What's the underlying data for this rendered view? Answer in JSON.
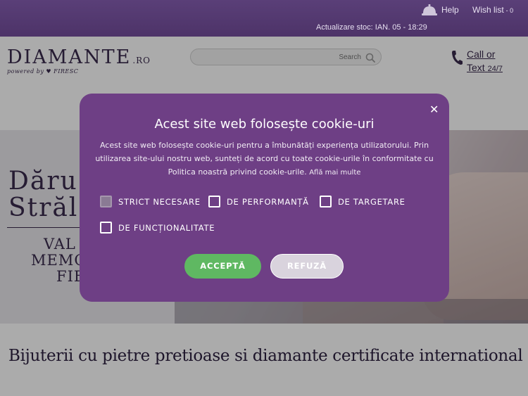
{
  "topbar": {
    "help_label": "Help",
    "wishlist_label": "Wish list",
    "wishlist_count": "- 0",
    "stock_update": "Actualizare stoc: IAN. 05 - 18:29"
  },
  "header": {
    "logo_main": "DIAMANTE",
    "logo_tld": ".RO",
    "logo_powered": "powered by ♥ FIRESC",
    "search_placeholder": "Search",
    "call_line1": "Call or",
    "call_line2": "Text",
    "call_hours": "24/7"
  },
  "hero": {
    "title_line1": "Dăru",
    "title_line2": "Străl",
    "sub_line1": "VAL",
    "sub_line2": "MEMO",
    "sub_line3": "FIE"
  },
  "tagline": "Bijuterii cu pietre pretioase si diamante certificate international",
  "cookie_modal": {
    "title": "Acest site web folosește cookie-uri",
    "description": "Acest site web folosește cookie-uri pentru a îmbunătăți experiența utilizatorului. Prin utilizarea site-ului nostru web, sunteți de acord cu toate cookie-urile în conformitate cu Politica noastră privind cookie-urile.",
    "learn_more": "Află mai multe",
    "close_label": "✕",
    "options": {
      "strict": "STRICT NECESARE",
      "performance": "DE PERFORMANȚĂ",
      "targeting": "DE TARGETARE",
      "functionality": "DE FUNCȚIONALITATE"
    },
    "accept_label": "ACCEPTĂ",
    "refuse_label": "REFUZĂ"
  },
  "colors": {
    "brand": "#3a2a4d",
    "modal_bg": "#6e3f85",
    "accept": "#5fb862"
  }
}
